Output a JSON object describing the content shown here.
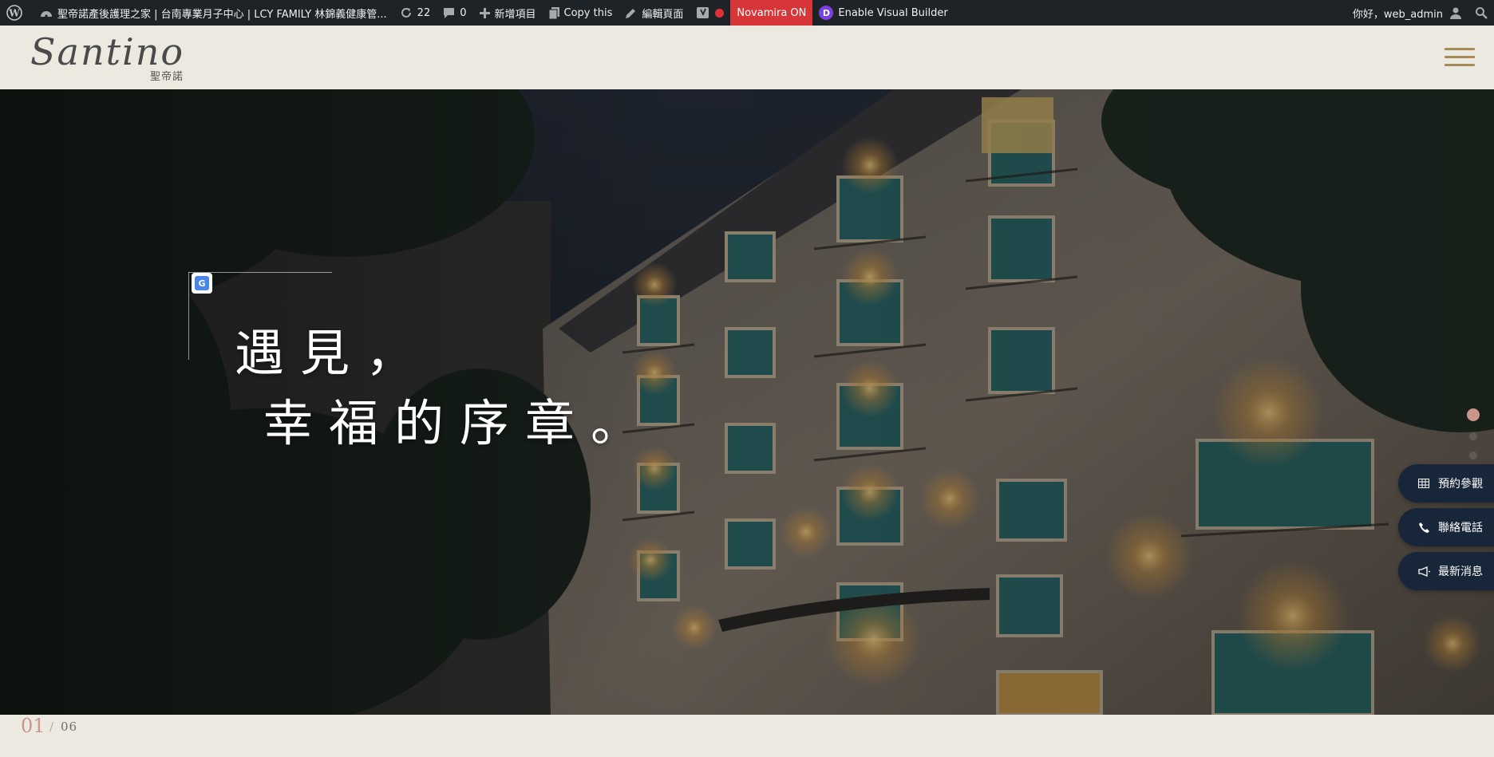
{
  "admin_bar": {
    "site_title": "聖帝諾產後護理之家 | 台南專業月子中心 | LCY FAMILY 林錦義健康管...",
    "updates_count": "22",
    "comments_count": "0",
    "new_label": "新增項目",
    "copy_label": "Copy this",
    "edit_label": "編輯頁面",
    "novamira_label": "Novamira ON",
    "visual_builder_label": "Enable Visual Builder",
    "divi_letter": "D",
    "greeting": "你好，web_admin"
  },
  "header": {
    "logo_script": "Santino",
    "logo_cn": "聖帝諾"
  },
  "hero": {
    "line1": "遇見，",
    "line2": "幸福的序章。",
    "translate_glyph": "G"
  },
  "slider": {
    "current": "01",
    "separator": "/",
    "total": "06",
    "dots_total": 6,
    "active_dot": 1
  },
  "float_buttons": {
    "reserve": "預約參觀",
    "phone": "聯絡電話",
    "news": "最新消息"
  },
  "colors": {
    "admin_bar": "#1d2327",
    "novamira": "#d63638",
    "menu_gold": "#a68a57",
    "accent_pink": "#c9958c",
    "float_navy": "#18263a",
    "page_bg": "#ece9e1"
  },
  "icons": {
    "wp": "wordpress-icon",
    "dashboard": "dashboard-icon",
    "updates": "updates-icon",
    "comments": "comments-icon",
    "new": "plus-icon",
    "copy": "copy-icon",
    "edit": "pencil-icon",
    "yoast": "yoast-icon",
    "user": "user-icon",
    "search": "search-icon",
    "menu": "hamburger-icon",
    "reserve": "grid-icon",
    "phone": "phone-icon",
    "news": "megaphone-icon"
  }
}
